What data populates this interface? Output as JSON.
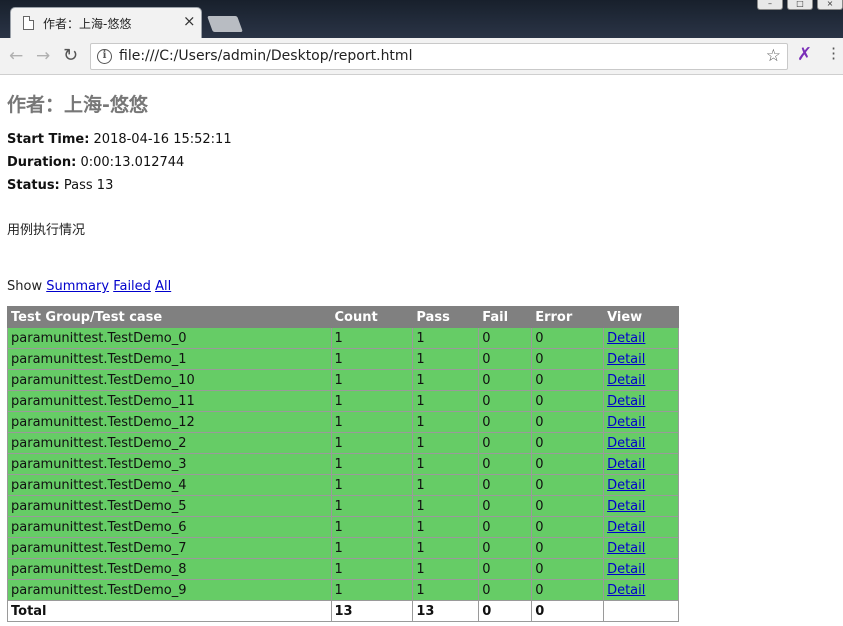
{
  "browser": {
    "tab_title": "作者：上海-悠悠",
    "tab_close": "×",
    "url": "file:///C:/Users/admin/Desktop/report.html",
    "back_icon": "arrow-left-icon",
    "forward_icon": "arrow-right-icon",
    "reload_icon": "reload-icon"
  },
  "report": {
    "title": "作者：上海-悠悠",
    "start_time_label": "Start Time:",
    "start_time": "2018-04-16 15:52:11",
    "duration_label": "Duration:",
    "duration": "0:00:13.012744",
    "status_label": "Status:",
    "status": "Pass 13",
    "description": "用例执行情况",
    "show_label": "Show",
    "filters": [
      "Summary",
      "Failed",
      "All"
    ]
  },
  "table": {
    "headers": [
      "Test Group/Test case",
      "Count",
      "Pass",
      "Fail",
      "Error",
      "View"
    ],
    "rows": [
      {
        "name": "paramunittest.TestDemo_0",
        "count": "1",
        "pass": "1",
        "fail": "0",
        "error": "0",
        "view": "Detail"
      },
      {
        "name": "paramunittest.TestDemo_1",
        "count": "1",
        "pass": "1",
        "fail": "0",
        "error": "0",
        "view": "Detail"
      },
      {
        "name": "paramunittest.TestDemo_10",
        "count": "1",
        "pass": "1",
        "fail": "0",
        "error": "0",
        "view": "Detail"
      },
      {
        "name": "paramunittest.TestDemo_11",
        "count": "1",
        "pass": "1",
        "fail": "0",
        "error": "0",
        "view": "Detail"
      },
      {
        "name": "paramunittest.TestDemo_12",
        "count": "1",
        "pass": "1",
        "fail": "0",
        "error": "0",
        "view": "Detail"
      },
      {
        "name": "paramunittest.TestDemo_2",
        "count": "1",
        "pass": "1",
        "fail": "0",
        "error": "0",
        "view": "Detail"
      },
      {
        "name": "paramunittest.TestDemo_3",
        "count": "1",
        "pass": "1",
        "fail": "0",
        "error": "0",
        "view": "Detail"
      },
      {
        "name": "paramunittest.TestDemo_4",
        "count": "1",
        "pass": "1",
        "fail": "0",
        "error": "0",
        "view": "Detail"
      },
      {
        "name": "paramunittest.TestDemo_5",
        "count": "1",
        "pass": "1",
        "fail": "0",
        "error": "0",
        "view": "Detail"
      },
      {
        "name": "paramunittest.TestDemo_6",
        "count": "1",
        "pass": "1",
        "fail": "0",
        "error": "0",
        "view": "Detail"
      },
      {
        "name": "paramunittest.TestDemo_7",
        "count": "1",
        "pass": "1",
        "fail": "0",
        "error": "0",
        "view": "Detail"
      },
      {
        "name": "paramunittest.TestDemo_8",
        "count": "1",
        "pass": "1",
        "fail": "0",
        "error": "0",
        "view": "Detail"
      },
      {
        "name": "paramunittest.TestDemo_9",
        "count": "1",
        "pass": "1",
        "fail": "0",
        "error": "0",
        "view": "Detail"
      }
    ],
    "total": {
      "label": "Total",
      "count": "13",
      "pass": "13",
      "fail": "0",
      "error": "0"
    }
  },
  "colors": {
    "pass_row": "#66cc66",
    "header_bg": "#808080",
    "title_color": "#777777",
    "link": "#0000cc"
  }
}
